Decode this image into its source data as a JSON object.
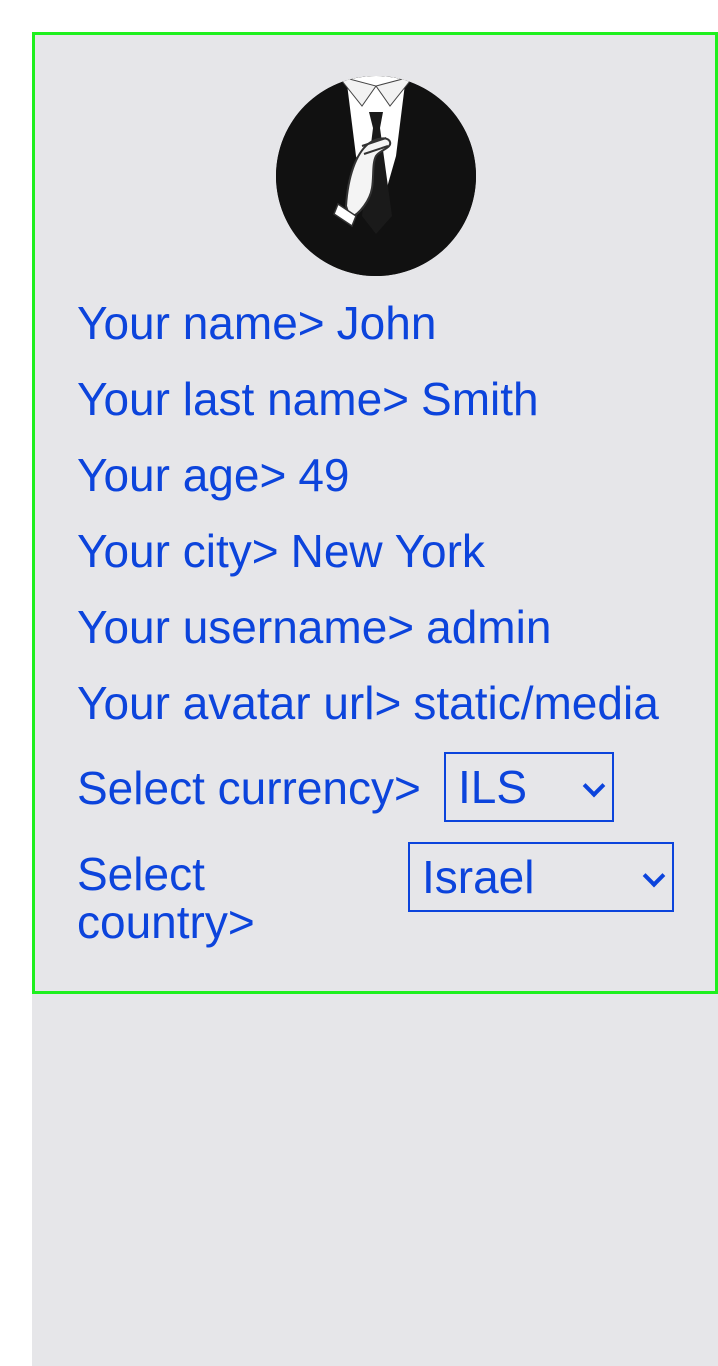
{
  "profile": {
    "avatar_alt": "avatar",
    "fields": [
      {
        "label": "Your name>",
        "value": "John"
      },
      {
        "label": "Your last name>",
        "value": "Smith"
      },
      {
        "label": "Your age>",
        "value": "49"
      },
      {
        "label": "Your city>",
        "value": "New York"
      },
      {
        "label": "Your username>",
        "value": "admin"
      },
      {
        "label": "Your avatar url>",
        "value": "static/media"
      }
    ],
    "currency": {
      "label": "Select currency>",
      "selected": "ILS"
    },
    "country": {
      "label": "Select country>",
      "selected": "Israel"
    }
  },
  "colors": {
    "text": "#0c44dc",
    "card_border": "#1ef01e",
    "background": "#e6e6e9"
  }
}
